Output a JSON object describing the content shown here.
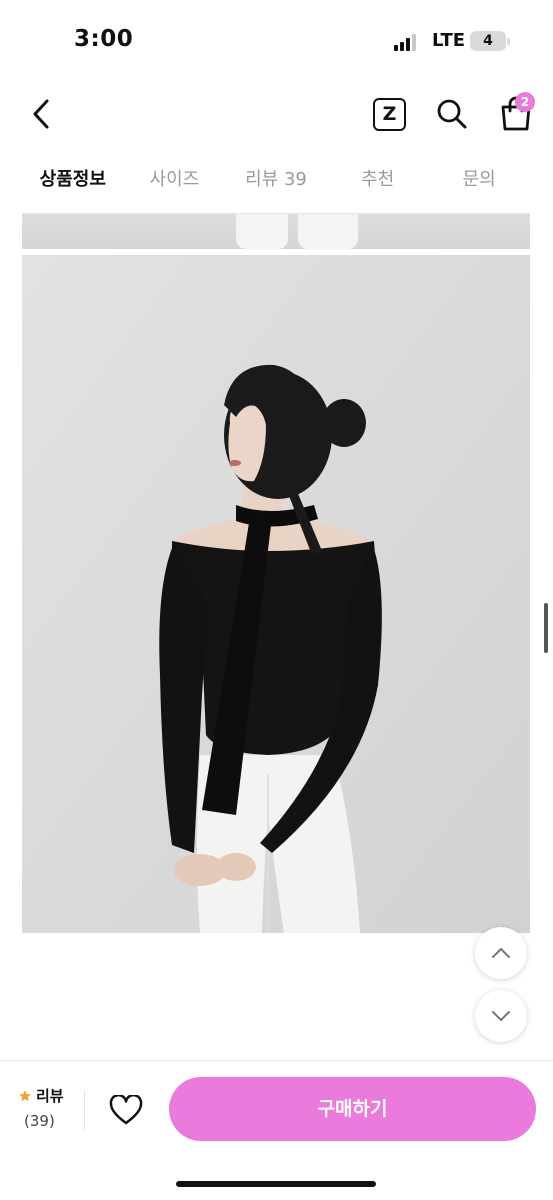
{
  "status_bar": {
    "time": "3:00",
    "network": "LTE",
    "battery": "4"
  },
  "header": {
    "z_label": "Z",
    "cart_badge": "2"
  },
  "tabs": [
    {
      "label": "상품정보",
      "active": true
    },
    {
      "label": "사이즈",
      "active": false
    },
    {
      "label": "리뷰 39",
      "active": false
    },
    {
      "label": "추천",
      "active": false
    },
    {
      "label": "문의",
      "active": false
    }
  ],
  "bottom_bar": {
    "review_label": "리뷰",
    "review_count": "(39)",
    "buy_label": "구매하기"
  },
  "colors": {
    "accent": "#ea7bdc",
    "badge": "#e77bd9",
    "star": "#f2a33a"
  },
  "icons": [
    "back-icon",
    "z-icon",
    "search-icon",
    "cart-icon",
    "chevron-up-icon",
    "chevron-down-icon",
    "star-icon",
    "heart-icon"
  ]
}
